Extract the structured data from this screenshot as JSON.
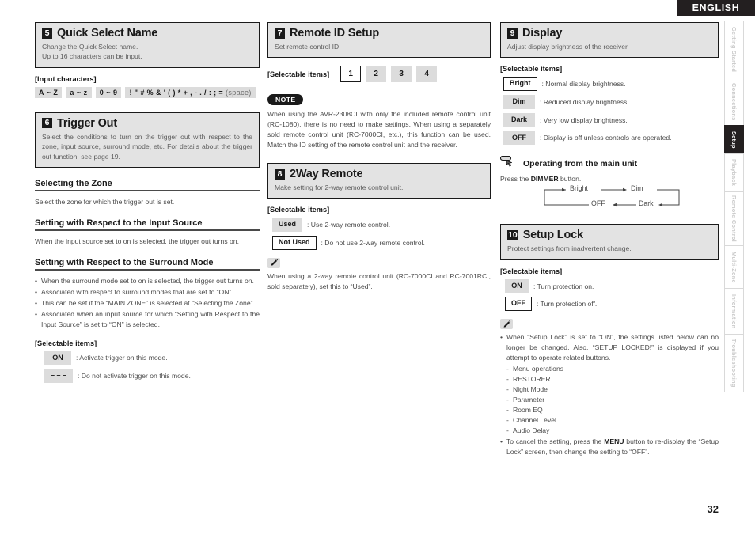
{
  "header": {
    "language": "ENGLISH"
  },
  "page": {
    "number": "32"
  },
  "sidebar": {
    "tabs": [
      {
        "label": "Getting Started",
        "active": false
      },
      {
        "label": "Connections",
        "active": false
      },
      {
        "label": "Setup",
        "active": true
      },
      {
        "label": "Playback",
        "active": false
      },
      {
        "label": "Remote Control",
        "active": false
      },
      {
        "label": "Multi-Zone",
        "active": false
      },
      {
        "label": "Information",
        "active": false
      },
      {
        "label": "Troubleshooting",
        "active": false
      }
    ]
  },
  "colors": {
    "accent": "#231f20",
    "chip_bg": "#dcdcdc",
    "panel_bg": "#e3e3e3"
  },
  "sections": {
    "quick_select_name": {
      "number": "5",
      "title": "Quick Select Name",
      "desc_line1": "Change the Quick Select name.",
      "desc_line2": "Up to 16 characters can be input.",
      "input_label": "[Input characters]",
      "chars": [
        {
          "text": "A ~ Z"
        },
        {
          "text": "a ~ z"
        },
        {
          "text": "0 ~ 9"
        }
      ],
      "symbols": "! \" # % & ' ( ) * + , - . / : ; =",
      "space_label": "(space)"
    },
    "trigger_out": {
      "number": "6",
      "title": "Trigger Out",
      "desc": "Select the conditions to turn on the trigger out with respect to the zone, input source, surround mode,  etc. For details about the trigger out function, see page 19.",
      "sub1_title": "Selecting the Zone",
      "sub1_text": "Select the zone for which the trigger out is set.",
      "sub2_title": "Setting with Respect to the Input Source",
      "sub2_text": "When the input source set to on is selected, the trigger out turns on.",
      "sub3_title": "Setting with Respect to the Surround Mode",
      "sub3_bullets": [
        "When the surround mode set to on is selected, the trigger out turns on.",
        "Associated with respect to surround modes that are set to “ON”.",
        "This can be set if the “MAIN ZONE” is selected at “Selecting the Zone”.",
        "Associated when an input source for which “Setting with Respect to the Input Source” is set to “ON” is selected."
      ],
      "selectable_label": "[Selectable items]",
      "options": [
        {
          "value": "ON",
          "selected": false,
          "desc": ": Activate trigger on this mode."
        },
        {
          "value": "– – –",
          "selected": false,
          "desc": ": Do not activate trigger on this mode."
        }
      ]
    },
    "remote_id_setup": {
      "number": "7",
      "title": "Remote ID Setup",
      "desc": "Set remote control ID.",
      "selectable_label": "[Selectable items]",
      "options": [
        {
          "value": "1",
          "selected": true
        },
        {
          "value": "2",
          "selected": false
        },
        {
          "value": "3",
          "selected": false
        },
        {
          "value": "4",
          "selected": false
        }
      ],
      "note_badge": "NOTE",
      "note_text": "When using the AVR-2308CI with only the included remote control unit (RC-1080), there is no need to make settings. When using a separately sold remote control unit (RC-7000CI, etc.), this function can be used. Match the ID setting of the remote control unit and the receiver."
    },
    "two_way_remote": {
      "number": "8",
      "title": "2Way Remote",
      "desc": "Make setting for 2-way remote control unit.",
      "selectable_label": "[Selectable items]",
      "options": [
        {
          "value": "Used",
          "selected": false,
          "desc": ": Use 2-way remote control."
        },
        {
          "value": "Not Used",
          "selected": true,
          "desc": ": Do not use 2-way remote control."
        }
      ],
      "tip_text": "When using a 2-way remote control unit (RC-7000CI and RC-7001RCI, sold separately), set this to “Used”."
    },
    "display": {
      "number": "9",
      "title": "Display",
      "desc": "Adjust display brightness of the receiver.",
      "selectable_label": "[Selectable items]",
      "options": [
        {
          "value": "Bright",
          "selected": true,
          "desc": ": Normal display brightness."
        },
        {
          "value": "Dim",
          "selected": false,
          "desc": ": Reduced display brightness."
        },
        {
          "value": "Dark",
          "selected": false,
          "desc": ": Very low display brightness."
        },
        {
          "value": "OFF",
          "selected": false,
          "desc": ": Display is off unless controls are operated."
        }
      ],
      "main_unit_title": "Operating from the main unit",
      "main_unit_press_pre": "Press the ",
      "main_unit_press_key": "DIMMER",
      "main_unit_press_post": " button.",
      "cycle": [
        "Bright",
        "Dim",
        "Dark",
        "OFF"
      ]
    },
    "setup_lock": {
      "number": "10",
      "title": "Setup Lock",
      "desc": "Protect settings from inadvertent change.",
      "selectable_label": "[Selectable items]",
      "options": [
        {
          "value": "ON",
          "selected": false,
          "desc": ": Turn protection on."
        },
        {
          "value": "OFF",
          "selected": true,
          "desc": ": Turn protection off."
        }
      ],
      "tip_bullet1": "When “Setup Lock” is set to “ON”, the settings listed below can no longer be changed. Also, “SETUP LOCKED!” is displayed if you attempt to operate related buttons.",
      "tip_list": [
        "Menu operations",
        "RESTORER",
        "Night Mode",
        "Parameter",
        "Room EQ",
        "Channel Level",
        "Audio Delay"
      ],
      "tip_bullet2_pre": "To cancel the setting, press the ",
      "tip_bullet2_key": "MENU",
      "tip_bullet2_post": " button to re-display the “Setup Lock” screen, then change the setting to “OFF”."
    }
  }
}
